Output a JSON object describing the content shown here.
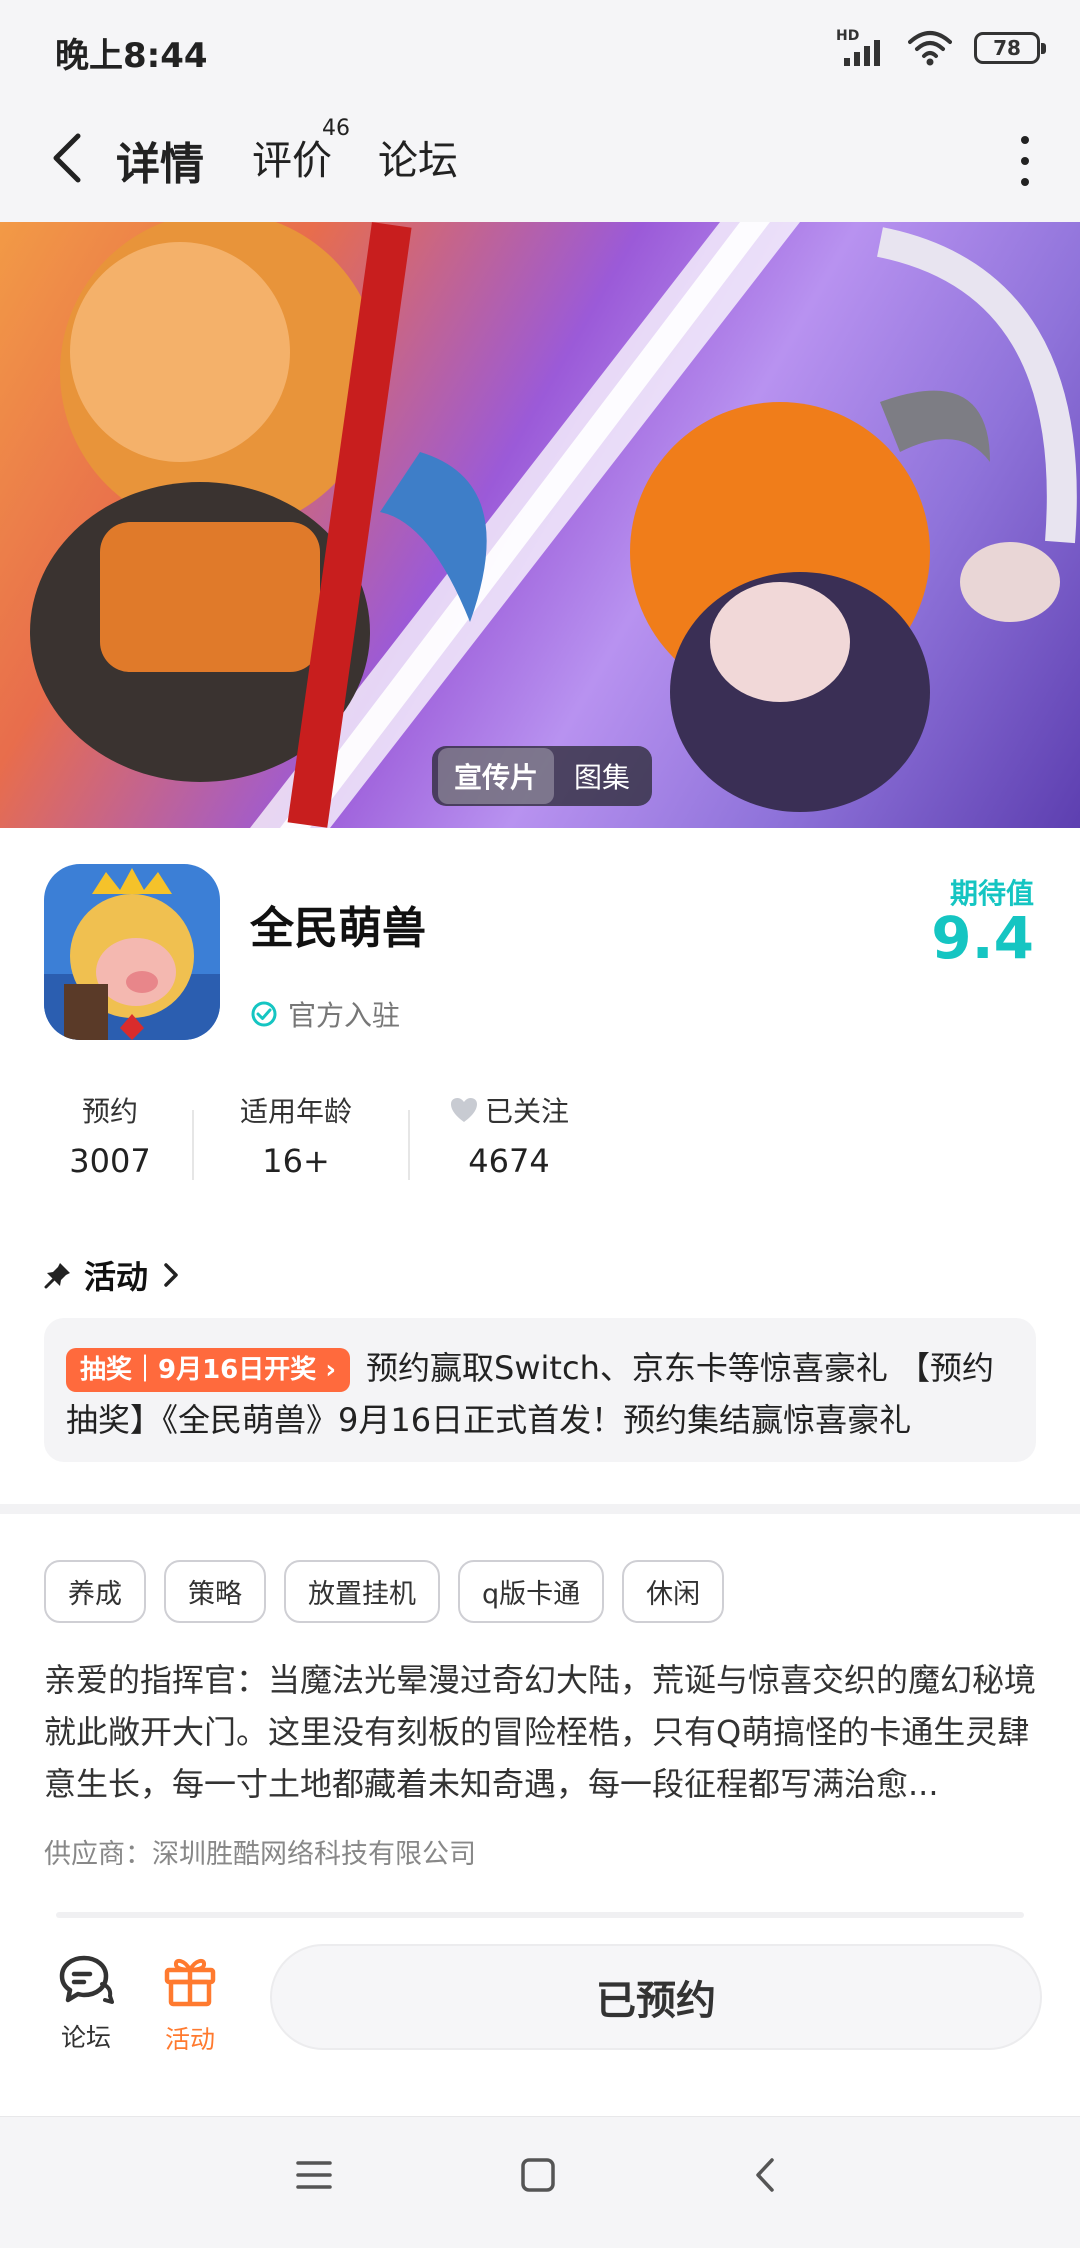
{
  "status_bar": {
    "time": "晚上8:44",
    "network_label": "HD",
    "battery": "78",
    "icons": [
      "signal-icon",
      "wifi-icon",
      "battery-icon"
    ]
  },
  "nav": {
    "tabs": [
      {
        "label": "详情",
        "active": true
      },
      {
        "label": "评价",
        "count": "46"
      },
      {
        "label": "论坛"
      }
    ],
    "back_icon": "chevron-left-icon",
    "more_icon": "more-vertical-icon"
  },
  "banner": {
    "toggle": [
      "宣传片",
      "图集"
    ],
    "active_toggle": "宣传片"
  },
  "game": {
    "name": "全民萌兽",
    "official_label": "官方入驻",
    "expect_label": "期待值",
    "expect_value": "9.4",
    "accent_color": "#15c5c2"
  },
  "stats": [
    {
      "label": "预约",
      "value": "3007"
    },
    {
      "label": "适用年龄",
      "value": "16+"
    },
    {
      "label": "已关注",
      "value": "4674"
    }
  ],
  "activity": {
    "title": "活动",
    "badge": "抽奖｜9月16日开奖 ›",
    "line1": "预约赢取Switch、京东卡等惊喜豪礼 【预约",
    "line2": "抽奖】《全民萌兽》9月16日正式首发！预约集结赢惊喜豪礼",
    "badge_color": "#ff6a3d"
  },
  "tags": [
    "养成",
    "策略",
    "放置挂机",
    "q版卡通",
    "休闲"
  ],
  "description": "亲爱的指挥官：当魔法光晕漫过奇幻大陆，荒诞与惊喜交织的魔幻秘境就此敞开大门。这里没有刻板的冒险桎梏，只有Q萌搞怪的卡通生灵肆意生长，每一寸土地都藏着未知奇遇，每一段征程都写满治愈...",
  "supplier": "供应商：深圳胜酷网络科技有限公司",
  "bottom_bar": {
    "forum_label": "论坛",
    "activity_label": "活动",
    "reserve_label": "已预约",
    "activity_color": "#ff7a2f"
  }
}
